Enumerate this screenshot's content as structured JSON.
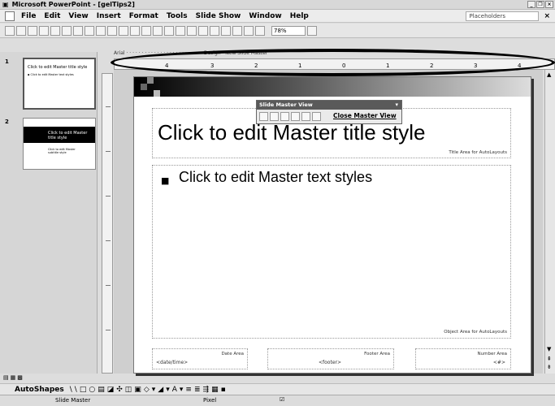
{
  "window": {
    "title": "Microsoft PowerPoint - [gelTips2]"
  },
  "menu": {
    "items": [
      "File",
      "Edit",
      "View",
      "Insert",
      "Format",
      "Tools",
      "Slide Show",
      "Window",
      "Help"
    ],
    "help_box": "Placeholders",
    "close": "×"
  },
  "toolbar": {
    "zoom": "78%"
  },
  "thumbnails": {
    "items": [
      {
        "number": "1",
        "title": "Click to edit Master title style",
        "body": "▪ Click to edit Master text styles"
      },
      {
        "number": "2",
        "title": "Click to edit Master title style",
        "body": "Click to edit Master subtitle style"
      }
    ]
  },
  "ruler": {
    "top_ticks": [
      "4",
      "3",
      "2",
      "1",
      "0",
      "1",
      "2",
      "3",
      "4"
    ],
    "drag_text": "Arial · · · · · · · · · · · · · · · · · · · · · · · · · Design · New Slide Master"
  },
  "slide_master_toolbar": {
    "title": "Slide Master View",
    "close_label": "Close Master View",
    "arrow": "▾"
  },
  "slide": {
    "title_text": "Click to edit Master title style",
    "title_area_label": "Title Area for AutoLayouts",
    "bullet": "■",
    "body_text": "Click to edit Master text styles",
    "object_area_label": "Object Area for AutoLayouts",
    "footer_areas": [
      {
        "label": "Date Area",
        "value": "<date/time>"
      },
      {
        "label": "Footer Area",
        "value": "<footer>"
      },
      {
        "label": "Number Area",
        "value": "<#>"
      }
    ]
  },
  "drawing_toolbar": {
    "autoshapes_label": "AutoShapes",
    "icons": [
      "\\",
      "\\",
      "□",
      "○",
      "▤",
      "◪",
      "✣",
      "◫",
      "▣",
      "◇",
      "▾",
      "◢",
      "▾",
      "A",
      "▾",
      "≡",
      "≣",
      "⇶",
      "▦",
      "▪"
    ]
  },
  "status": {
    "view": "Slide Master",
    "design": "Pixel",
    "icon": "☑"
  },
  "view_buttons": [
    "▤",
    "▦",
    "▩"
  ]
}
